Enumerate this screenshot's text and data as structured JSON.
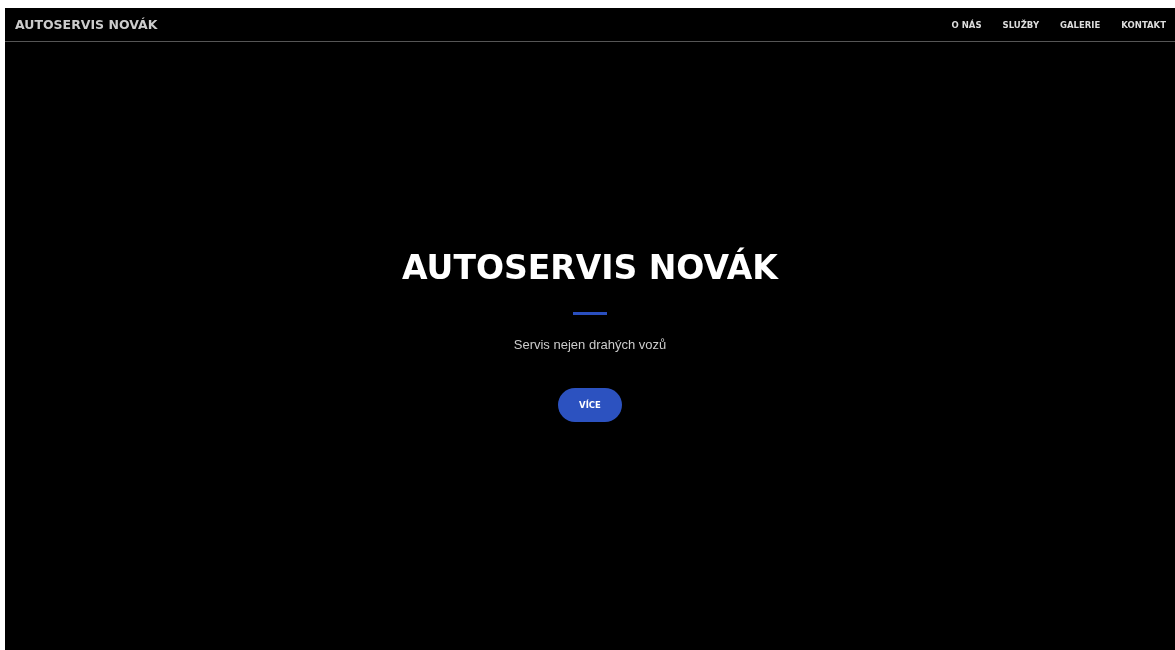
{
  "navbar": {
    "brand": "AUTOSERVIS NOVÁK",
    "links": [
      "O NÁS",
      "SLUŽBY",
      "GALERIE",
      "KONTAKT"
    ]
  },
  "hero": {
    "title": "AUTOSERVIS NOVÁK",
    "subtitle": "Servis nejen drahých vozů",
    "button": "VÍCE"
  }
}
